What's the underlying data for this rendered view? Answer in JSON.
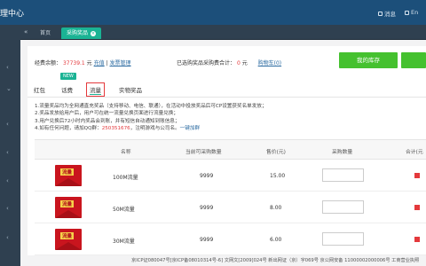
{
  "header": {
    "brand": "理中心",
    "messages_label": "消息",
    "lang_label": "En"
  },
  "tabs": {
    "home": "首页",
    "active": "采购奖品",
    "close": "×"
  },
  "summary": {
    "balance_label": "经费余额：",
    "balance_value": "37739.1",
    "balance_unit": "元",
    "recharge": "充值",
    "invoice": "发票管理",
    "purchased_label": "已选购奖品采购费合计：",
    "purchased_value": "0",
    "purchased_unit": "元",
    "cart": "购物车(0)"
  },
  "actions": {
    "inventory": "我的库存",
    "second": ""
  },
  "categories": {
    "items": [
      "红包",
      "话费",
      "流量",
      "实物奖品"
    ],
    "new_badge": "NEW"
  },
  "notes": [
    "1.流量奖品均为全网通直充奖品（支持移动、电信、联通），在活动中投放奖品后可CP设置获奖名单发放；",
    "2.奖品发放给用户后，用户可在统一流量兑换页面进行流量兑换；",
    "3.用户兑换后72小时内奖品会到账，并有短信自动通知到账信息；",
    "4.如有任何问题，请加QQ群：",
    "250351676",
    "，注明游戏与公司名。",
    "一键加群"
  ],
  "table": {
    "headers": [
      "名称",
      "当前可采购数量",
      "售价(元)",
      "采购数量",
      "合计(元"
    ],
    "rows": [
      {
        "name": "100M流量",
        "qty": "9999",
        "price": "15.00",
        "img_label": "流量"
      },
      {
        "name": "50M流量",
        "qty": "9999",
        "price": "8.00",
        "img_label": "流量"
      },
      {
        "name": "30M流量",
        "qty": "9999",
        "price": "6.00",
        "img_label": "流量"
      }
    ]
  },
  "footer": "京ICP证080047号[京ICP备08010314号-6] 文网文[2009]024号 新出网证（京）字069号 京公网安备 11000002000006号 工商营业执照",
  "colors": {
    "header": "#1c4f7a",
    "sidebar": "#2f4050",
    "accent": "#1ab394",
    "primary_button": "#45c12f",
    "highlight": "#e4393c"
  }
}
